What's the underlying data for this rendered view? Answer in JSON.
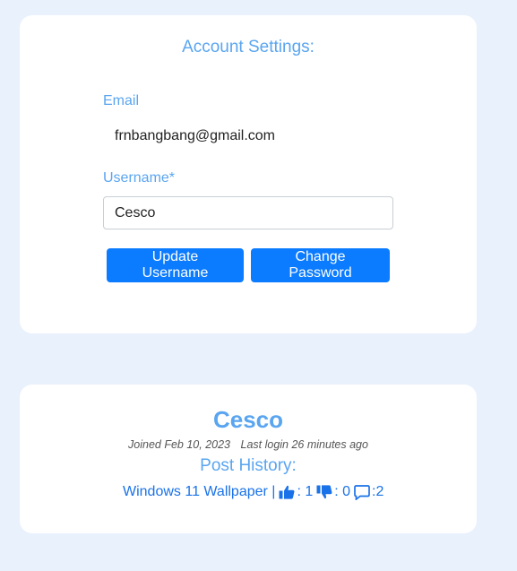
{
  "settings": {
    "title": "Account Settings:",
    "email_label": "Email",
    "email_value": "frnbangbang@gmail.com",
    "username_label": "Username*",
    "username_value": "Cesco",
    "update_button": "Update Username",
    "password_button": "Change Password"
  },
  "profile": {
    "name": "Cesco",
    "joined": "Joined Feb 10, 2023",
    "last_login": "Last login 26 minutes ago",
    "post_history_title": "Post History:",
    "posts": [
      {
        "title": "Windows 11 Wallpaper |",
        "likes": ": 1",
        "dislikes": ": 0",
        "comments": ":2"
      }
    ]
  },
  "colors": {
    "background": "#e9f1fc",
    "accent": "#5aa5f0",
    "button": "#0b7bff",
    "link": "#1a72e8"
  },
  "icons": [
    "thumbs-up-icon",
    "thumbs-down-icon",
    "comment-icon"
  ]
}
